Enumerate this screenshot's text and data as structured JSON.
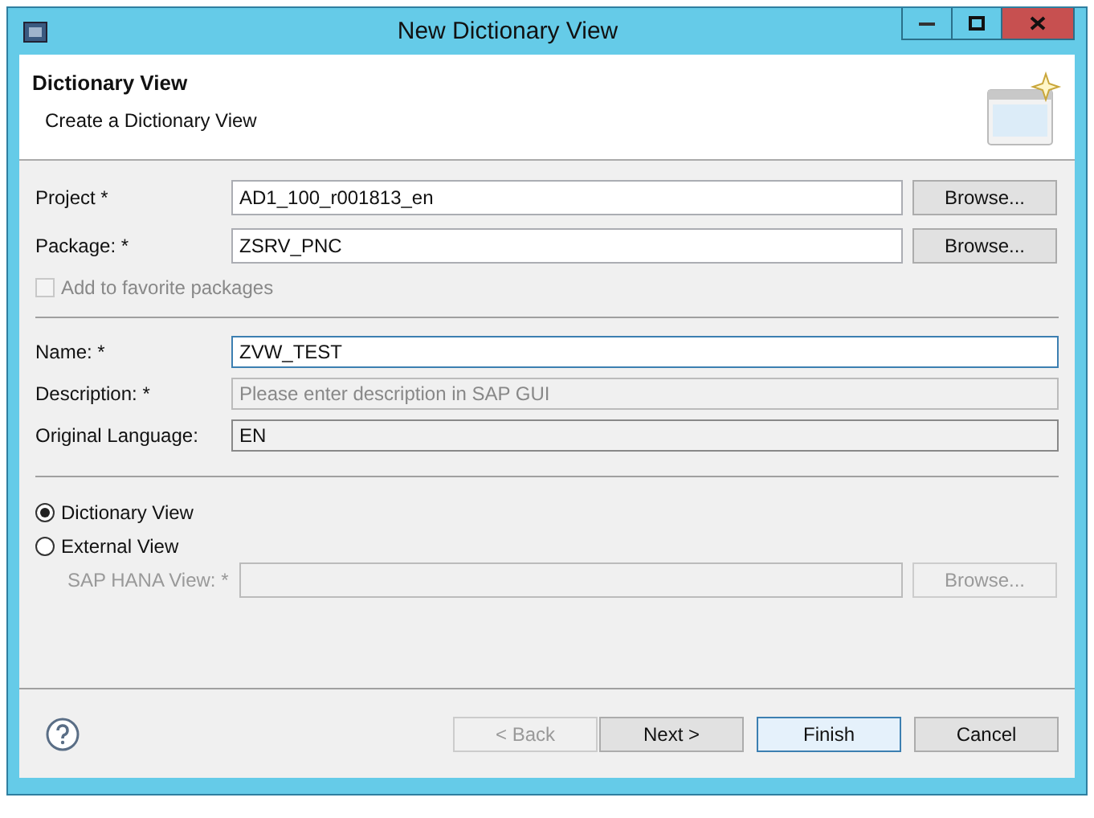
{
  "window": {
    "title": "New Dictionary View"
  },
  "header": {
    "title": "Dictionary View",
    "subtitle": "Create a Dictionary View"
  },
  "project_fields": [
    {
      "label": "Project *",
      "value": "AD1_100_r001813_en",
      "button": "Browse..."
    },
    {
      "label": "Package: *",
      "value": "ZSRV_PNC",
      "button": "Browse..."
    }
  ],
  "favorite_checkbox": {
    "label": "Add to favorite packages",
    "checked": false,
    "disabled": true
  },
  "details": [
    {
      "label": "Name: *",
      "value": "ZVW_TEST",
      "editable": true,
      "focused": true
    },
    {
      "label": "Description: *",
      "placeholder": "Please enter description in SAP GUI",
      "editable": false,
      "focused": false
    },
    {
      "label": "Original Language:",
      "value": "EN",
      "editable": false,
      "focused": false
    }
  ],
  "view_types": [
    {
      "label": "Dictionary View",
      "selected": true
    },
    {
      "label": "External View",
      "selected": false
    }
  ],
  "hana_view": {
    "label": "SAP HANA View: *",
    "button": "Browse...",
    "disabled": true
  },
  "buttons": [
    {
      "label": "< Back",
      "disabled": true,
      "default": false
    },
    {
      "label": "Next >",
      "disabled": false,
      "default": false
    },
    {
      "label": "Finish",
      "disabled": false,
      "default": true
    },
    {
      "label": "Cancel",
      "disabled": false,
      "default": false
    }
  ]
}
